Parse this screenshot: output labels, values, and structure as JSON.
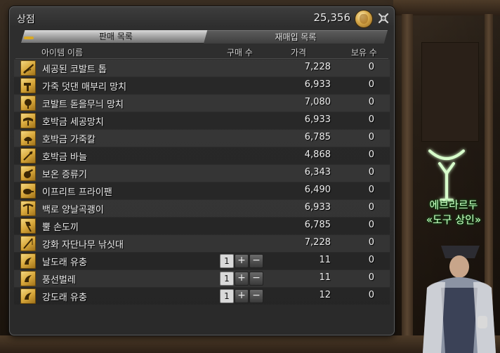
{
  "window": {
    "title": "상점",
    "gil_amount": "25,356"
  },
  "tabs": [
    {
      "label": "판매 목록",
      "active": true
    },
    {
      "label": "재매입 목록",
      "active": false
    }
  ],
  "columns": {
    "item_name": "아이템 이름",
    "purchase_qty": "구매 수",
    "price": "가격",
    "owned": "보유 수"
  },
  "items": [
    {
      "name": "세공된 코발트 톱",
      "price": "7,228",
      "owned": "0",
      "icon": "saw-icon"
    },
    {
      "name": "가죽 덧댄 매부리 망치",
      "price": "6,933",
      "owned": "0",
      "icon": "hammer-icon"
    },
    {
      "name": "코발트 돋을무늬 망치",
      "price": "7,080",
      "owned": "0",
      "icon": "raising-hammer-icon"
    },
    {
      "name": "호박금 세공망치",
      "price": "6,933",
      "owned": "0",
      "icon": "chaser-hammer-icon"
    },
    {
      "name": "호박금 가죽칼",
      "price": "6,785",
      "owned": "0",
      "icon": "head-knife-icon"
    },
    {
      "name": "호박금 바늘",
      "price": "4,868",
      "owned": "0",
      "icon": "needle-icon"
    },
    {
      "name": "보온 증류기",
      "price": "6,343",
      "owned": "0",
      "icon": "alembic-icon"
    },
    {
      "name": "이프리트 프라이팬",
      "price": "6,490",
      "owned": "0",
      "icon": "frypan-icon"
    },
    {
      "name": "백로 양날곡괭이",
      "price": "6,933",
      "owned": "0",
      "icon": "pickaxe-icon"
    },
    {
      "name": "뿔 손도끼",
      "price": "6,785",
      "owned": "0",
      "icon": "hatchet-icon"
    },
    {
      "name": "강화 자단나무 낚싯대",
      "price": "7,228",
      "owned": "0",
      "icon": "fishing-rod-icon"
    },
    {
      "name": "날도래 유충",
      "price": "11",
      "owned": "0",
      "icon": "lure-icon",
      "qty": "1"
    },
    {
      "name": "풍선벌레",
      "price": "11",
      "owned": "0",
      "icon": "lure-icon",
      "qty": "1"
    },
    {
      "name": "강도래 유충",
      "price": "12",
      "owned": "0",
      "icon": "lure-icon",
      "qty": "1"
    }
  ],
  "npc": {
    "name": "에브라르두",
    "title": "«도구 상인»"
  }
}
